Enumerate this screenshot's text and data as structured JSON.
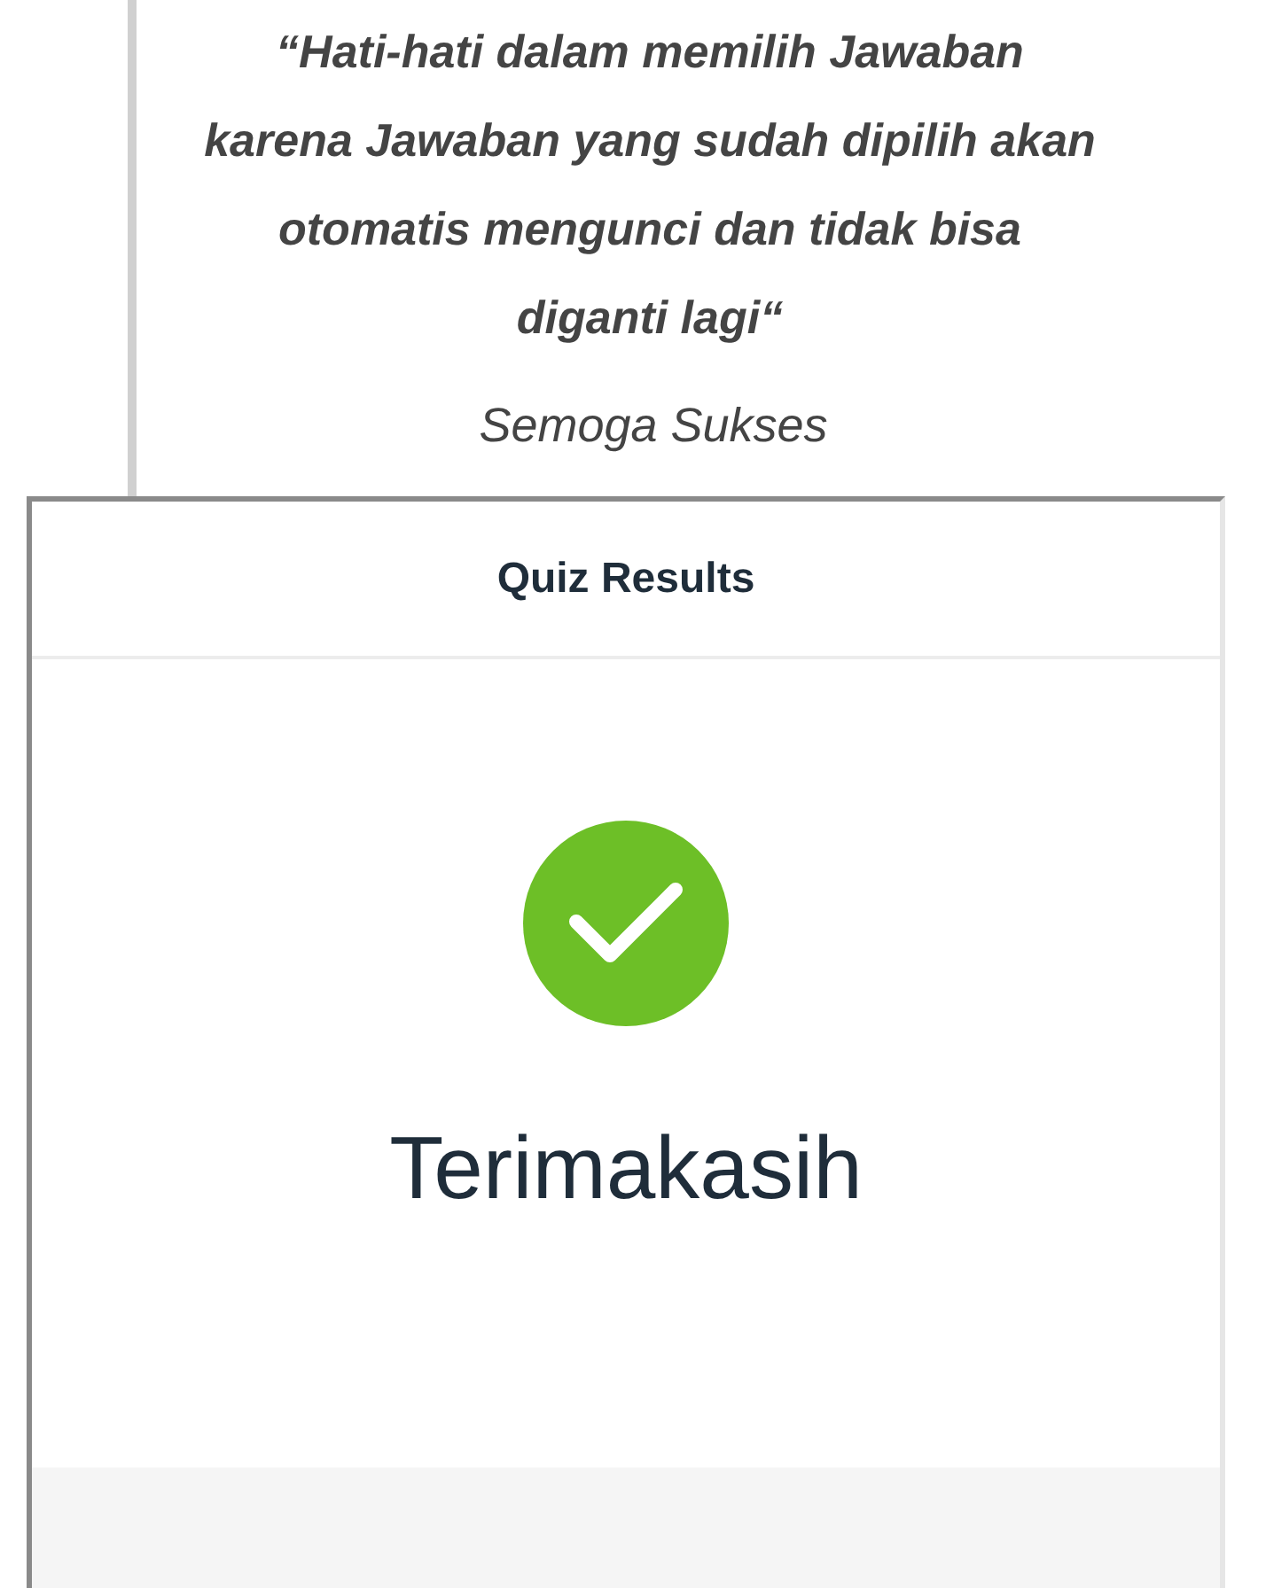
{
  "quote": {
    "text": "“Hati-hati dalam memilih Jawaban karena Jawaban yang sudah dipilih akan otomatis mengunci dan tidak bisa diganti lagi“",
    "closing": "Semoga Sukses"
  },
  "results": {
    "title": "Quiz Results",
    "kind": "success",
    "message": "Terimakasih"
  }
}
